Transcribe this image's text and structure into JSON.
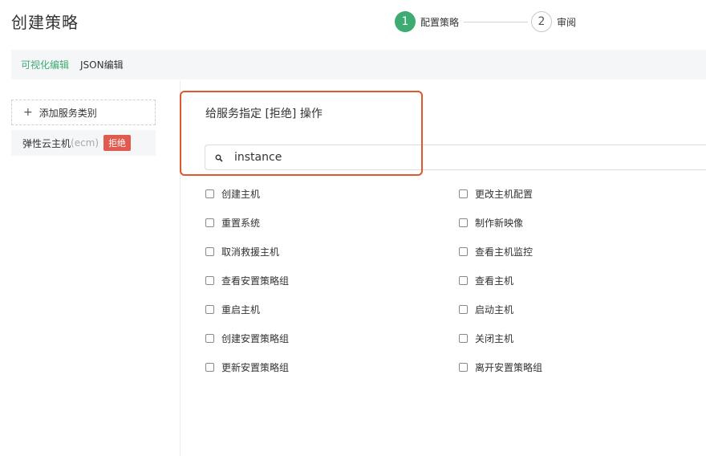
{
  "page": {
    "title": "创建策略"
  },
  "steps": [
    {
      "number": "1",
      "label": "配置策略",
      "active": true
    },
    {
      "number": "2",
      "label": "审阅",
      "active": false
    }
  ],
  "mode_tabs": [
    {
      "label": "可视化编辑",
      "active": true
    },
    {
      "label": "JSON编辑",
      "active": false
    }
  ],
  "sidebar": {
    "add_label": "添加服务类别",
    "service": {
      "name": "弹性云主机",
      "abbr": "(ecm)",
      "effect": "拒绝"
    }
  },
  "panel": {
    "title": "给服务指定 [拒绝] 操作",
    "search_value": "instance"
  },
  "actions_left": [
    "创建主机",
    "重置系统",
    "取消救援主机",
    "查看安置策略组",
    "重启主机",
    "创建安置策略组",
    "更新安置策略组"
  ],
  "actions_right": [
    "更改主机配置",
    "制作新映像",
    "查看主机监控",
    "查看主机",
    "启动主机",
    "关闭主机",
    "离开安置策略组"
  ],
  "colors": {
    "accent": "#3dab72",
    "deny": "#e05a4f",
    "highlight": "#e0562f"
  }
}
